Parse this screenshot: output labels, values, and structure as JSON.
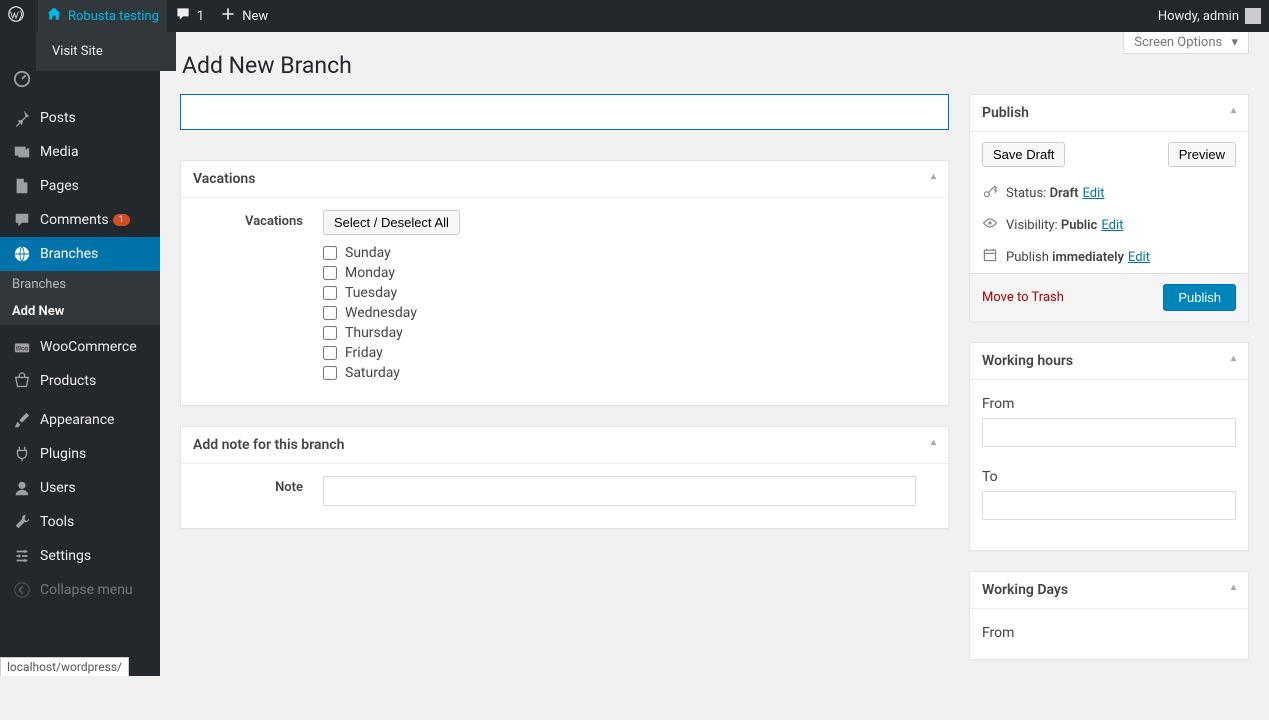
{
  "adminbar": {
    "site_name": "Robusta testing",
    "comments_count": "1",
    "new_label": "New",
    "howdy": "Howdy, admin",
    "visit_site": "Visit Site"
  },
  "menu": {
    "posts": "Posts",
    "media": "Media",
    "pages": "Pages",
    "comments": "Comments",
    "comments_badge": "1",
    "branches": "Branches",
    "branches_sub": "Branches",
    "branches_add": "Add New",
    "woocommerce": "WooCommerce",
    "products": "Products",
    "appearance": "Appearance",
    "plugins": "Plugins",
    "users": "Users",
    "tools": "Tools",
    "settings": "Settings",
    "collapse": "Collapse menu"
  },
  "screen_options": "Screen Options",
  "page_title": "Add New Branch",
  "title_value": "",
  "vacations": {
    "box_title": "Vacations",
    "label": "Vacations",
    "select_all": "Select / Deselect All",
    "days": [
      "Sunday",
      "Monday",
      "Tuesday",
      "Wednesday",
      "Thursday",
      "Friday",
      "Saturday"
    ]
  },
  "note": {
    "box_title": "Add note for this branch",
    "label": "Note",
    "value": ""
  },
  "publish": {
    "box_title": "Publish",
    "save_draft": "Save Draft",
    "preview": "Preview",
    "status_label": "Status:",
    "status_value": "Draft",
    "visibility_label": "Visibility:",
    "visibility_value": "Public",
    "publish_label": "Publish",
    "publish_value": "immediately",
    "edit": "Edit",
    "trash": "Move to Trash",
    "publish_button": "Publish"
  },
  "working_hours": {
    "box_title": "Working hours",
    "from_label": "From",
    "to_label": "To",
    "from_value": "",
    "to_value": ""
  },
  "working_days": {
    "box_title": "Working Days",
    "from_label": "From"
  },
  "statusbar": "localhost/wordpress/"
}
